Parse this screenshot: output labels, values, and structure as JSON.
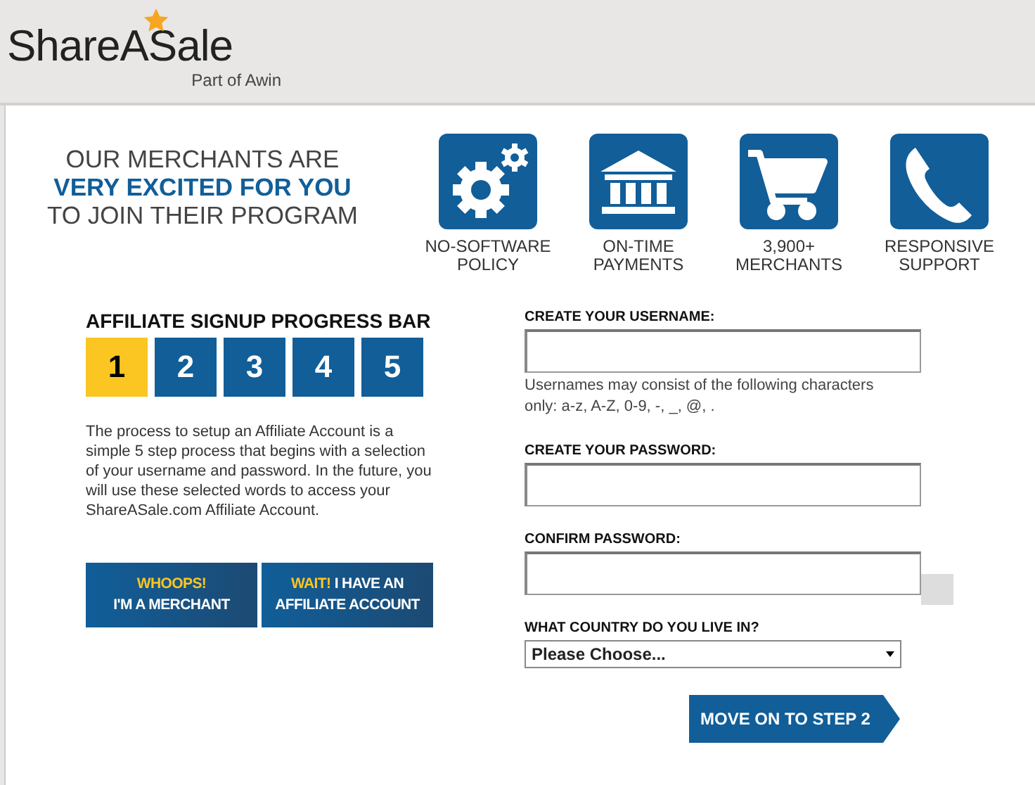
{
  "header": {
    "logo": "ShareASale",
    "tagline": "Part of Awin"
  },
  "headline": [
    {
      "text": "OUR MERCHANTS ARE",
      "emphasis": false
    },
    {
      "text": "VERY EXCITED FOR YOU",
      "emphasis": true
    },
    {
      "text": "TO JOIN THEIR PROGRAM",
      "emphasis": false
    }
  ],
  "features": [
    {
      "kind": "gear",
      "label": "NO-SOFTWARE POLICY"
    },
    {
      "kind": "bank",
      "label": "ON-TIME PAYMENTS"
    },
    {
      "kind": "cart",
      "label": "3,900+ MERCHANTS"
    },
    {
      "kind": "phone",
      "label": "RESPONSIVE SUPPORT"
    }
  ],
  "progress": {
    "title": "AFFILIATE SIGNUP PROGRESS BAR",
    "steps": [
      {
        "label": "1",
        "selected": true
      },
      {
        "label": "2",
        "selected": false
      },
      {
        "label": "3",
        "selected": false
      },
      {
        "label": "4",
        "selected": false
      },
      {
        "label": "5",
        "selected": false
      }
    ]
  },
  "description": "The process to setup an Affiliate Account is a simple 5 step process that begins with a selection of your username and password. In the future, you will use these selected words to access your ShareASale.com Affiliate Account.",
  "buttons": [
    {
      "highlight": "WHOOPS!",
      "text": "I'M A MERCHANT"
    },
    {
      "highlight": "WAIT!",
      "text": "I HAVE AN AFFILIATE ACCOUNT"
    }
  ],
  "form": {
    "fields": [
      {
        "label": "CREATE YOUR USERNAME:",
        "help": "Usernames may consist of the following characters only: a-z, A-Z, 0-9, -, _, @, ."
      },
      {
        "label": "CREATE YOUR PASSWORD:"
      },
      {
        "label": "CONFIRM PASSWORD:"
      }
    ],
    "country": {
      "label": "WHAT COUNTRY DO YOU LIVE IN?",
      "value": "Please Choose..."
    },
    "submit": "MOVE ON TO STEP 2"
  }
}
